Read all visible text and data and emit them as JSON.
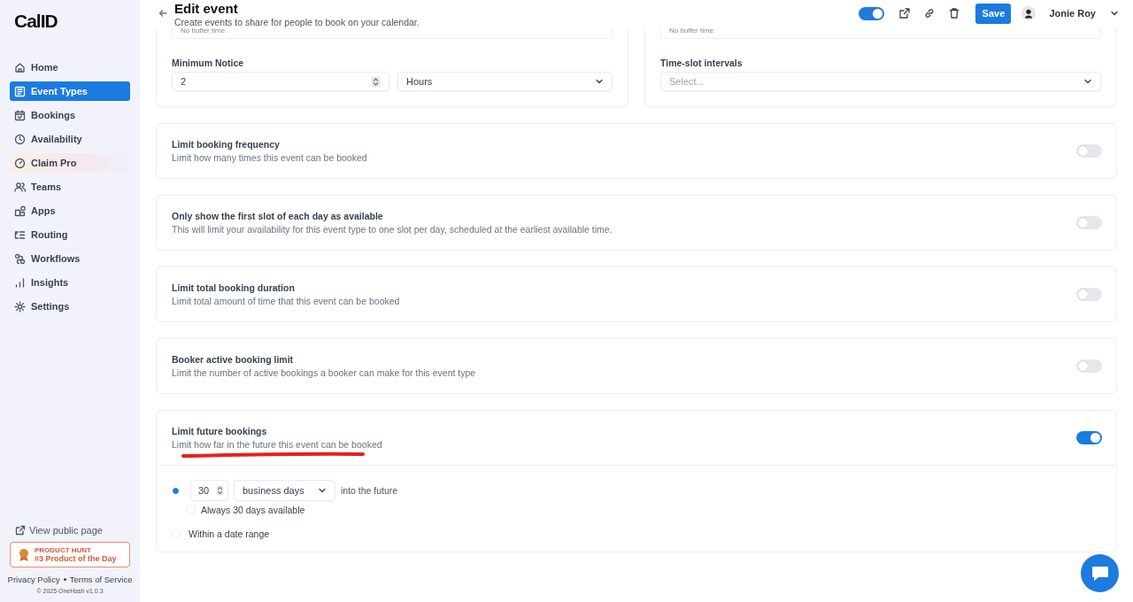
{
  "sidebar": {
    "logo": "CalID",
    "items": [
      {
        "label": "Home",
        "selected": false,
        "kind": "nav"
      },
      {
        "label": "Event Types",
        "selected": true,
        "kind": "nav"
      },
      {
        "label": "Bookings",
        "selected": false,
        "kind": "nav"
      },
      {
        "label": "Availability",
        "selected": false,
        "kind": "nav"
      },
      {
        "label": "Claim Pro",
        "selected": false,
        "kind": "promo"
      },
      {
        "label": "Teams",
        "selected": false,
        "kind": "nav"
      },
      {
        "label": "Apps",
        "selected": false,
        "kind": "nav"
      },
      {
        "label": "Routing",
        "selected": false,
        "kind": "nav"
      },
      {
        "label": "Workflows",
        "selected": false,
        "kind": "nav"
      },
      {
        "label": "Insights",
        "selected": false,
        "kind": "nav"
      },
      {
        "label": "Settings",
        "selected": false,
        "kind": "nav"
      }
    ],
    "view_public_page": "View public page",
    "badge": {
      "caption": "PRODUCT HUNT",
      "text": "#3 Product of the Day"
    },
    "footer_links": [
      "Privacy Policy",
      "Terms of Service"
    ],
    "copyright": "© 2025 OneHash v1.0.3"
  },
  "header": {
    "title": "Edit event",
    "subtitle": "Create events to share for people to book on your calendar.",
    "hidden_toggle_on": true,
    "save": "Save",
    "user": "Jonie Roy"
  },
  "top_cards": [
    {
      "buffer": "No buffer time",
      "label": "Minimum Notice",
      "number": "2",
      "unit": "Hours"
    },
    {
      "buffer": "No buffer time",
      "label": "Time-slot intervals",
      "placeholder": "Select..."
    }
  ],
  "limits": [
    {
      "title": "Limit booking frequency",
      "description": "Limit how many times this event can be booked",
      "on": false
    },
    {
      "title": "Only show the first slot of each day as available",
      "description": "This will limit your availability for this event type to one slot per day, scheduled at the earliest available time.",
      "on": false
    },
    {
      "title": "Limit total booking duration",
      "description": "Limit total amount of time that this event can be booked",
      "on": false
    },
    {
      "title": "Booker active booking limit",
      "description": "Limit the number of active bookings a booker can make for this event type",
      "on": false
    },
    {
      "title": "Limit future bookings",
      "description": "Limit how far in the future this event can be booked",
      "on": true,
      "underlined": true,
      "options": [
        {
          "kind": "rolling",
          "selected": true,
          "value": "30",
          "unit": "business days",
          "suffix": "into the future",
          "sub_option": {
            "label": "Always 30 days available",
            "checked": false
          }
        },
        {
          "kind": "range",
          "selected": false,
          "label": "Within a date range"
        }
      ]
    }
  ]
}
